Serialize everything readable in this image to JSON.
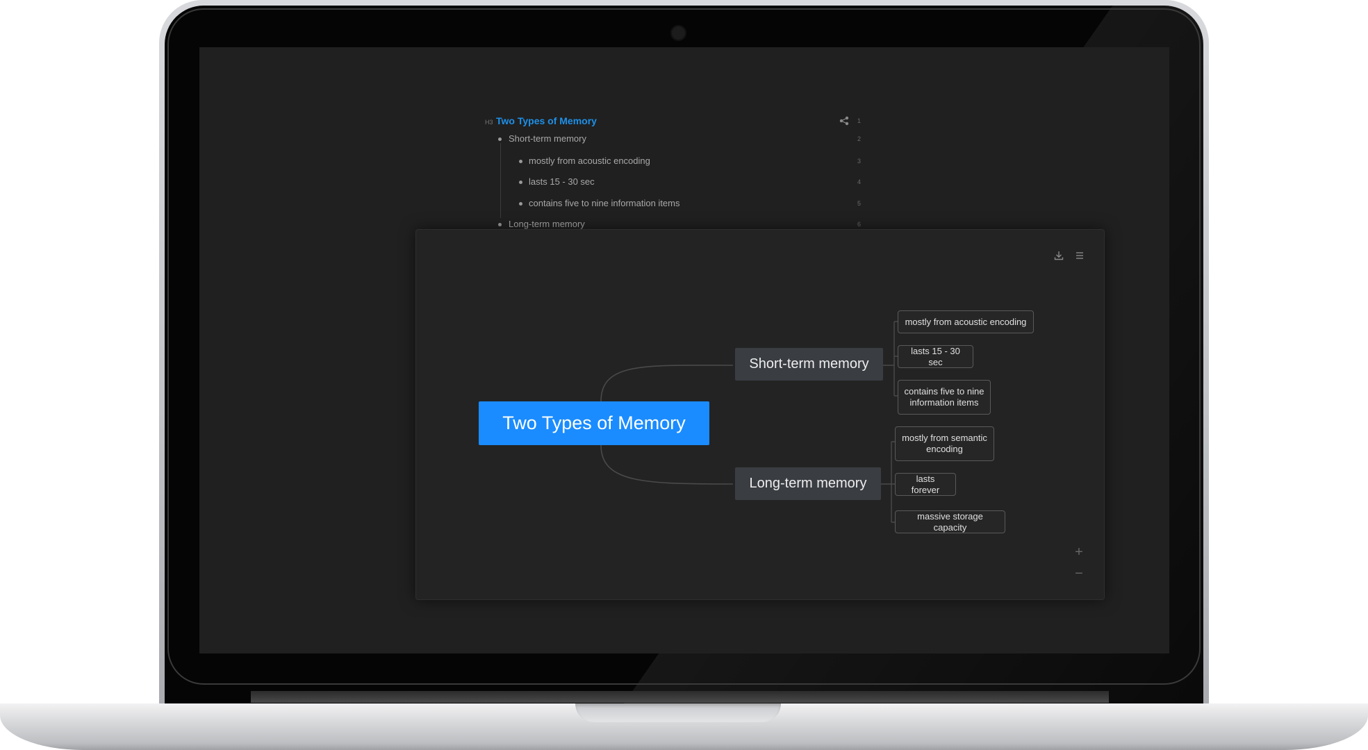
{
  "outline": {
    "heading_tag": "H3",
    "title": "Two Types of Memory",
    "items": [
      {
        "text": "Short-term memory",
        "line": "2"
      },
      {
        "text": "mostly from acoustic encoding",
        "line": "3"
      },
      {
        "text": "lasts 15 - 30 sec",
        "line": "4"
      },
      {
        "text": "contains five to nine information items",
        "line": "5"
      },
      {
        "text": "Long-term memory",
        "line": "6"
      }
    ],
    "title_line": "1"
  },
  "mindmap": {
    "root": "Two Types of Memory",
    "branches": [
      {
        "label": "Short-term memory",
        "children": [
          "mostly from acoustic encoding",
          "lasts 15 - 30 sec",
          "contains five to nine information items"
        ]
      },
      {
        "label": "Long-term memory",
        "children": [
          "mostly from semantic encoding",
          "lasts forever",
          "massive storage capacity"
        ]
      }
    ],
    "zoom_in": "+",
    "zoom_out": "−"
  },
  "icons": {
    "share": "mindmap-share-icon",
    "download": "download-icon",
    "menu": "menu-icon",
    "camera": "camera-icon"
  },
  "colors": {
    "accent": "#1a8cff",
    "title": "#1e90e8",
    "screen_bg": "#202020",
    "branch_bg": "#3a3d42"
  }
}
